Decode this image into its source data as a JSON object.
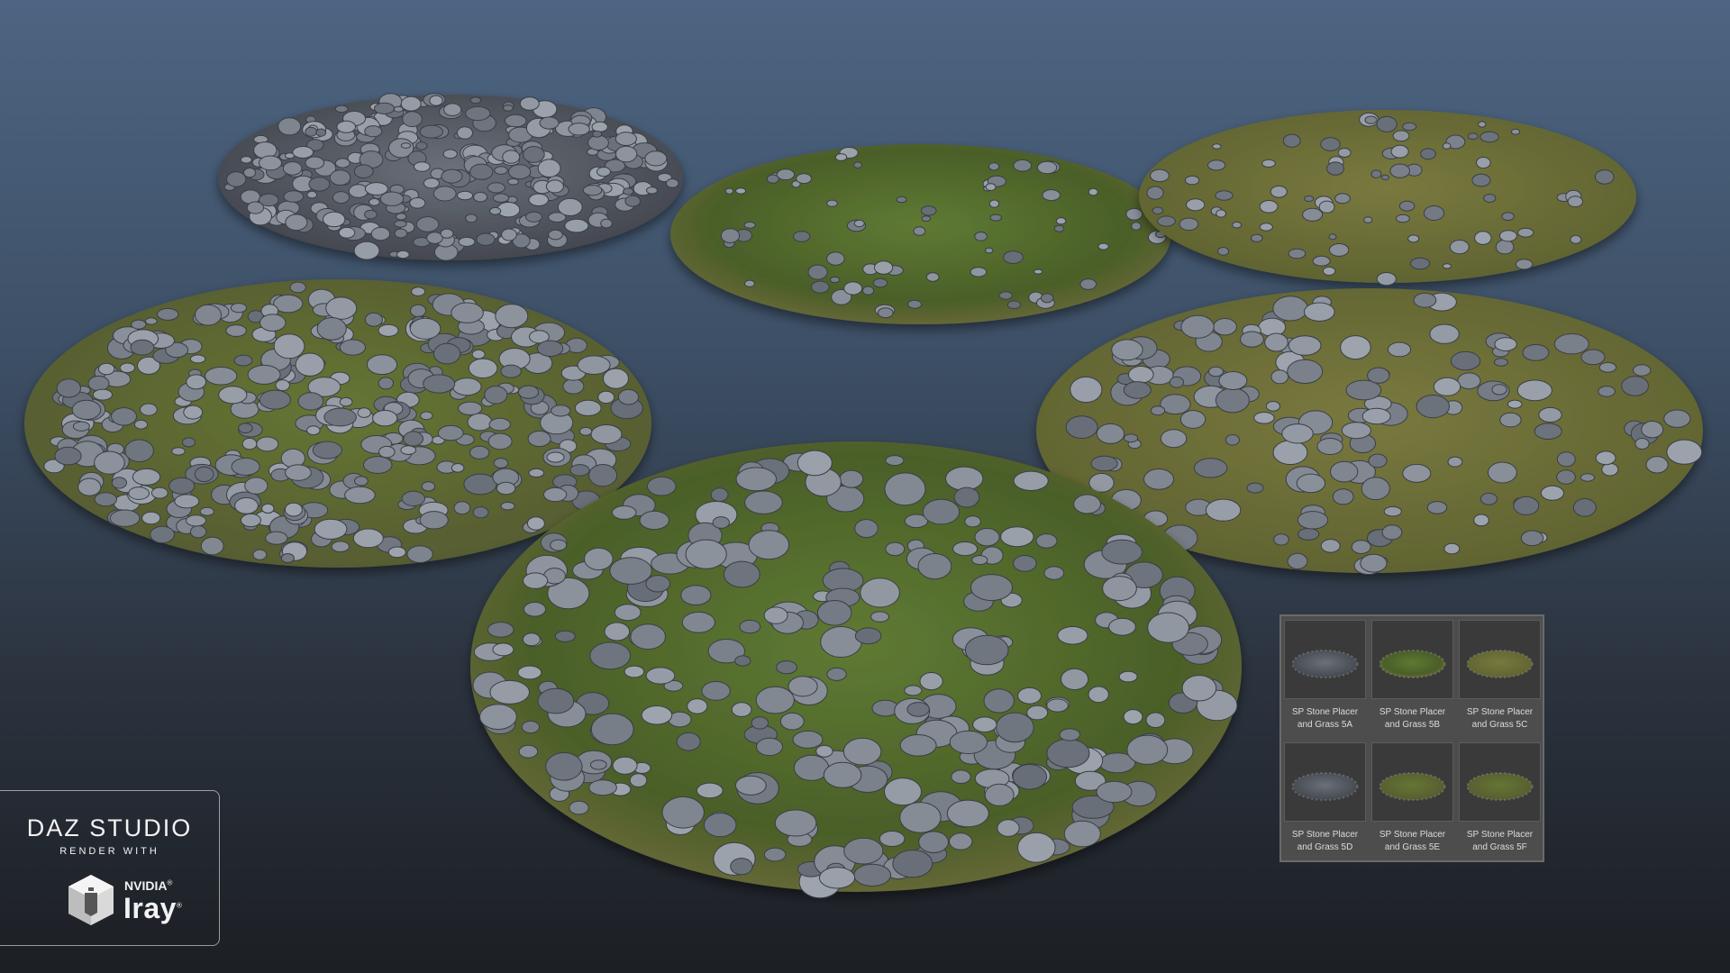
{
  "badge": {
    "brand_line": "DAZ STUDIO",
    "render_line": "RENDER WITH",
    "nvidia_label": "NVIDIA",
    "iray_label": "Iray",
    "registered_mark": "®"
  },
  "products": [
    {
      "line1": "SP Stone Placer",
      "line2": "and Grass 5A",
      "palette": "stone"
    },
    {
      "line1": "SP Stone Placer",
      "line2": "and Grass 5B",
      "palette": "grass"
    },
    {
      "line1": "SP Stone Placer",
      "line2": "and Grass 5C",
      "palette": "dry"
    },
    {
      "line1": "SP Stone Placer",
      "line2": "and Grass 5D",
      "palette": "stone"
    },
    {
      "line1": "SP Stone Placer",
      "line2": "and Grass 5E",
      "palette": "mixed"
    },
    {
      "line1": "SP Stone Placer",
      "line2": "and Grass 5F",
      "palette": "mixed"
    }
  ],
  "colors": {
    "stone": "#8b929a",
    "stone_dark": "#4b5057",
    "grass": "#4f6a2c",
    "grass_dry": "#7d7a46",
    "badge_text": "#f2f2f2",
    "panel_bg": "#4d4d4d"
  }
}
